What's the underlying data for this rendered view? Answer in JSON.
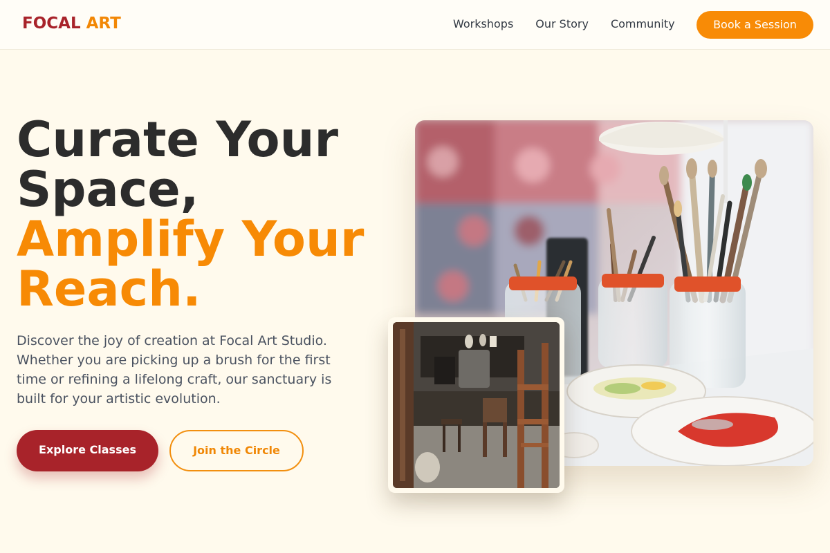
{
  "brand": {
    "part1": "FOCAL",
    "part2": "ART"
  },
  "nav": {
    "links": [
      "Workshops",
      "Our Story",
      "Community"
    ],
    "cta": "Book a Session"
  },
  "hero": {
    "headline_line1": "Curate Your",
    "headline_line2": "Space,",
    "headline_accent1": "Amplify Your",
    "headline_accent2": "Reach.",
    "description": "Discover the joy of creation at Focal Art Studio. Whether you are picking up a brush for the first time or refining a lifelong craft, our sanctuary is built for your artistic evolution.",
    "primary_button": "Explore Classes",
    "secondary_button": "Join the Circle"
  },
  "colors": {
    "background": "#fffaed",
    "brand_red": "#a8232a",
    "brand_orange": "#f88b06",
    "text_dark": "#2c2c2c",
    "text_body": "#4a5260"
  }
}
